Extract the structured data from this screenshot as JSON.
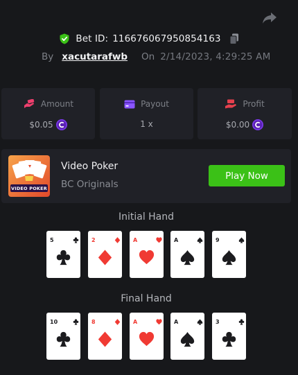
{
  "header": {
    "bet_id_label": "Bet ID:",
    "bet_id": "116676067950854163",
    "by_label": "By",
    "username": "xacutarafwb",
    "on_label": "On",
    "date": "2/14/2023, 4:29:25 AM"
  },
  "stats": {
    "amount": {
      "label": "Amount",
      "value": "$0.05"
    },
    "payout": {
      "label": "Payout",
      "value": "1 x"
    },
    "profit": {
      "label": "Profit",
      "value": "$0.00"
    }
  },
  "game": {
    "name": "Video Poker",
    "provider": "BC Originals",
    "thumbnail_text": "VIDEO POKER",
    "play_label": "Play Now"
  },
  "initial_hand": {
    "title": "Initial Hand",
    "cards": [
      {
        "rank": "5",
        "suit": "clubs"
      },
      {
        "rank": "2",
        "suit": "diamonds"
      },
      {
        "rank": "A",
        "suit": "hearts"
      },
      {
        "rank": "A",
        "suit": "spades"
      },
      {
        "rank": "9",
        "suit": "spades"
      }
    ]
  },
  "final_hand": {
    "title": "Final Hand",
    "cards": [
      {
        "rank": "10",
        "suit": "clubs"
      },
      {
        "rank": "8",
        "suit": "diamonds"
      },
      {
        "rank": "A",
        "suit": "hearts"
      },
      {
        "rank": "A",
        "suit": "spades"
      },
      {
        "rank": "3",
        "suit": "clubs"
      }
    ]
  },
  "colors": {
    "background": "#17181b",
    "panel": "#202127",
    "accent_green": "#3bc117",
    "red_suit": "#f03a33",
    "amount_icon": "#ef3f6d",
    "payout_icon": "#8a55ff",
    "profit_icon": "#e5404d",
    "coin": "#7c3aed"
  }
}
